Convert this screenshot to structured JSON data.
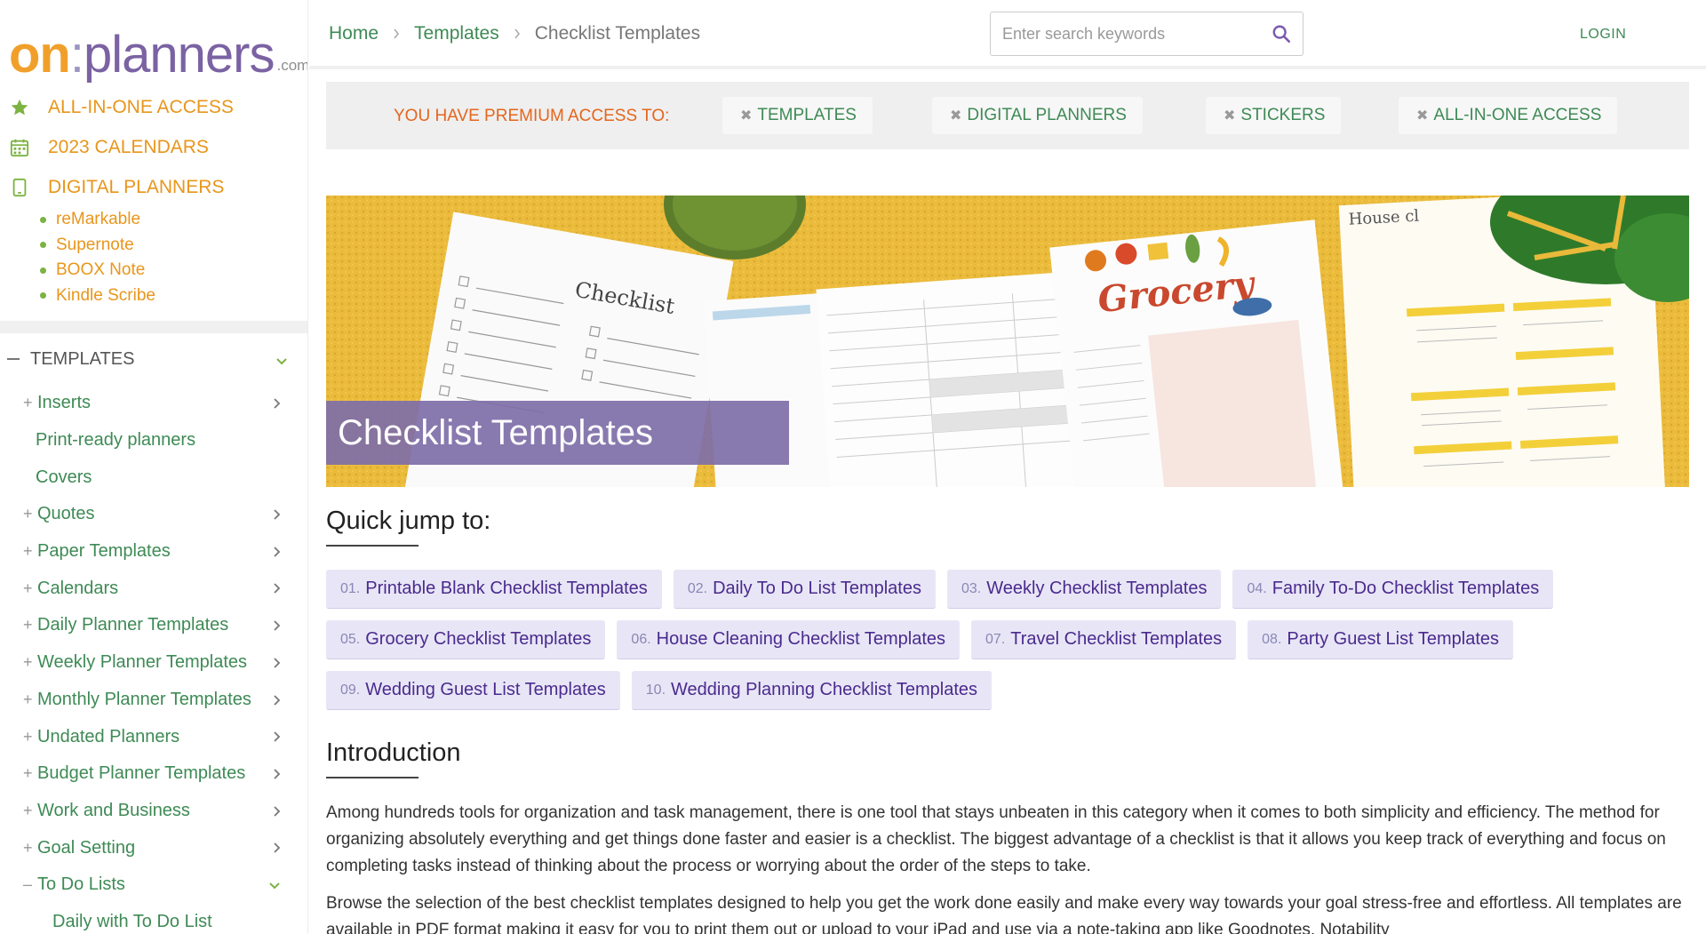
{
  "logo": {
    "on": "on",
    "colon": ":",
    "planners": "planners",
    "com": ".com"
  },
  "topnav": [
    {
      "label": "ALL-IN-ONE ACCESS",
      "icon": "star-icon"
    },
    {
      "label": "2023 CALENDARS",
      "icon": "calendar-icon"
    },
    {
      "label": "DIGITAL PLANNERS",
      "icon": "tablet-icon"
    }
  ],
  "digital_subnav": [
    "reMarkable",
    "Supernote",
    "BOOX Note",
    "Kindle Scribe"
  ],
  "sidebar": {
    "templates_label": "TEMPLATES",
    "items": [
      {
        "label": "Inserts",
        "expandable": true
      },
      {
        "label": "Print-ready planners",
        "expandable": false
      },
      {
        "label": "Covers",
        "expandable": false
      },
      {
        "label": "Quotes",
        "expandable": true
      },
      {
        "label": "Paper Templates",
        "expandable": true
      },
      {
        "label": "Calendars",
        "expandable": true
      },
      {
        "label": "Daily Planner Templates",
        "expandable": true
      },
      {
        "label": "Weekly Planner Templates",
        "expandable": true
      },
      {
        "label": "Monthly Planner Templates",
        "expandable": true
      },
      {
        "label": "Undated Planners",
        "expandable": true
      },
      {
        "label": "Budget Planner Templates",
        "expandable": true
      },
      {
        "label": "Work and Business",
        "expandable": true
      },
      {
        "label": "Goal Setting",
        "expandable": true
      },
      {
        "label": "To Do Lists",
        "expandable": true,
        "open": true
      },
      {
        "label": "Daily with To Do List",
        "sub": true
      }
    ]
  },
  "breadcrumb": {
    "home": "Home",
    "templates": "Templates",
    "current": "Checklist Templates"
  },
  "search": {
    "placeholder": "Enter search keywords"
  },
  "login": "LOGIN",
  "premium": {
    "label": "YOU HAVE PREMIUM ACCESS TO:",
    "tags": [
      "TEMPLATES",
      "DIGITAL PLANNERS",
      "STICKERS",
      "ALL-IN-ONE ACCESS"
    ]
  },
  "hero": {
    "title": "Checklist Templates",
    "img_checklist": "Checklist",
    "img_grocery": "Grocery",
    "img_house": "House cl"
  },
  "quick_jump": {
    "heading": "Quick jump to:",
    "links": [
      {
        "num": "01.",
        "label": "Printable Blank Checklist Templates"
      },
      {
        "num": "02.",
        "label": "Daily To Do List Templates"
      },
      {
        "num": "03.",
        "label": "Weekly Checklist Templates"
      },
      {
        "num": "04.",
        "label": "Family To-Do Checklist Templates"
      },
      {
        "num": "05.",
        "label": "Grocery Checklist Templates"
      },
      {
        "num": "06.",
        "label": "House Cleaning Checklist Templates"
      },
      {
        "num": "07.",
        "label": "Travel Checklist Templates"
      },
      {
        "num": "08.",
        "label": "Party Guest List Templates"
      },
      {
        "num": "09.",
        "label": "Wedding Guest List Templates"
      },
      {
        "num": "10.",
        "label": "Wedding Planning Checklist Templates"
      }
    ]
  },
  "introduction": {
    "heading": "Introduction",
    "p1": "Among hundreds tools for organization and task management, there is one tool that stays unbeaten in this category when it comes to both simplicity and efficiency. The method for organizing absolutely everything and get things done faster and easier is a checklist. The biggest advantage of a checklist is that it allows you keep track of everything and focus on completing tasks instead of thinking about the process or worrying about the order of the steps to take.",
    "p2": "Browse the selection of the best checklist templates designed to help you get the work done easily and make every way towards your goal stress-free and effortless. All templates are available in PDF format making it easy for you to print them out or upload to your iPad and use via a note-taking app like Goodnotes, Notability"
  },
  "colors": {
    "accent_orange": "#e8961b",
    "link_green": "#3e8a55",
    "purple": "#7e6ea8",
    "premium_orange": "#e4661d"
  }
}
